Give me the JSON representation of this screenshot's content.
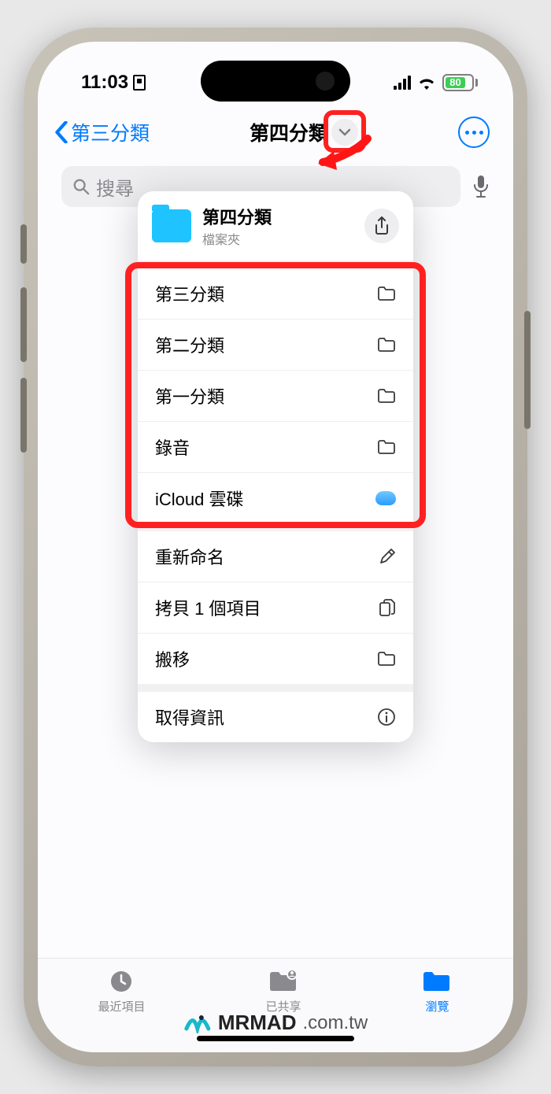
{
  "status": {
    "time": "11:03",
    "battery_pct": "80"
  },
  "nav": {
    "back_label": "第三分類",
    "title": "第四分類"
  },
  "search": {
    "placeholder": "搜尋"
  },
  "popup": {
    "title": "第四分類",
    "subtitle": "檔案夾",
    "nav_items": [
      {
        "label": "第三分類",
        "icon": "folder"
      },
      {
        "label": "第二分類",
        "icon": "folder"
      },
      {
        "label": "第一分類",
        "icon": "folder"
      },
      {
        "label": "錄音",
        "icon": "folder"
      },
      {
        "label": "iCloud 雲碟",
        "icon": "icloud"
      }
    ],
    "actions_a": [
      {
        "label": "重新命名",
        "icon": "pencil"
      },
      {
        "label": "拷貝 1 個項目",
        "icon": "copy"
      },
      {
        "label": "搬移",
        "icon": "folder"
      }
    ],
    "actions_b": [
      {
        "label": "取得資訊",
        "icon": "info"
      }
    ]
  },
  "tabs": [
    {
      "label": "最近項目",
      "icon": "clock",
      "active": false
    },
    {
      "label": "已共享",
      "icon": "shared",
      "active": false
    },
    {
      "label": "瀏覽",
      "icon": "browse",
      "active": true
    }
  ],
  "watermark": {
    "brand": "MRMAD",
    "domain": ".com.tw"
  }
}
